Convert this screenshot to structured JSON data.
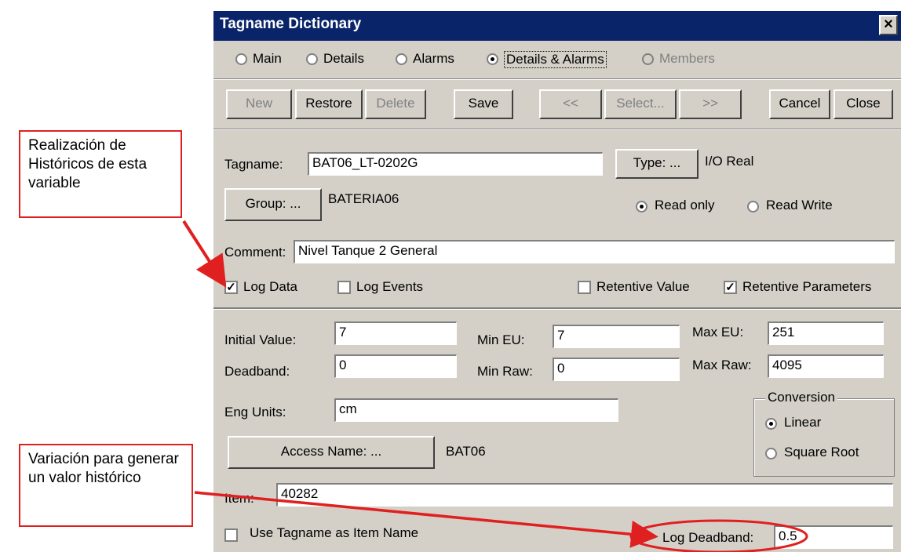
{
  "dialog": {
    "title": "Tagname Dictionary",
    "close_glyph": "×"
  },
  "tabs": {
    "main": "Main",
    "details": "Details",
    "alarms": "Alarms",
    "details_alarms": "Details & Alarms",
    "members": "Members",
    "selected": "details_alarms"
  },
  "toolbar": {
    "new": "New",
    "restore": "Restore",
    "delete": "Delete",
    "save": "Save",
    "prev": "<<",
    "select": "Select...",
    "next": ">>",
    "cancel": "Cancel",
    "close": "Close"
  },
  "tag": {
    "tagname_label": "Tagname:",
    "tagname_value": "BAT06_LT-0202G",
    "type_button": "Type: ...",
    "type_value": "I/O Real",
    "group_button": "Group: ...",
    "group_value": "BATERIA06",
    "read_only": "Read only",
    "read_write": "Read Write",
    "comment_label": "Comment:",
    "comment_value": "Nivel Tanque 2 General",
    "log_data": "Log Data",
    "log_events": "Log Events",
    "retentive_value": "Retentive Value",
    "retentive_parameters": "Retentive Parameters"
  },
  "details": {
    "initial_value_label": "Initial Value:",
    "initial_value": "7",
    "min_eu_label": "Min EU:",
    "min_eu": "7",
    "max_eu_label": "Max EU:",
    "max_eu": "251",
    "deadband_label": "Deadband:",
    "deadband": "0",
    "min_raw_label": "Min Raw:",
    "min_raw": "0",
    "max_raw_label": "Max Raw:",
    "max_raw": "4095",
    "eng_units_label": "Eng Units:",
    "eng_units": "cm",
    "conversion_title": "Conversion",
    "linear": "Linear",
    "square_root": "Square Root",
    "access_name_button": "Access Name: ...",
    "access_name_value": "BAT06",
    "item_label": "Item:",
    "item_value": "40282",
    "use_tagname": "Use Tagname as Item Name",
    "log_deadband_label": "Log Deadband:",
    "log_deadband": "0.5"
  },
  "annotations": {
    "historicos": "Realización de Históricos de esta variable",
    "variacion": "Variación para generar un valor histórico"
  },
  "colors": {
    "titlebar": "#0a246a",
    "dialog": "#d4d0c8",
    "annotation": "#e02020"
  }
}
